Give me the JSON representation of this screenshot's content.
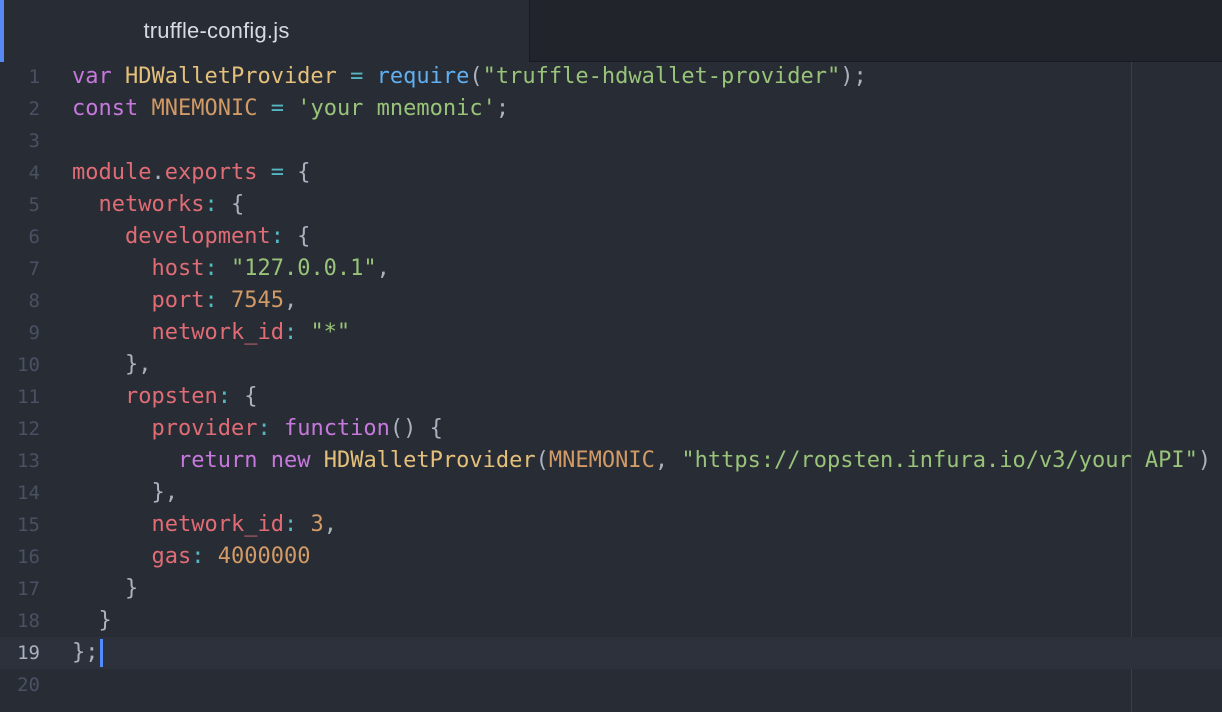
{
  "tab": {
    "title": "truffle-config.js"
  },
  "editor": {
    "cursor_line": 19,
    "lines": [
      {
        "number": "1",
        "tokens": [
          {
            "t": "var",
            "c": "keyword"
          },
          {
            "t": " ",
            "c": "punct"
          },
          {
            "t": "HDWalletProvider",
            "c": "class"
          },
          {
            "t": " ",
            "c": "punct"
          },
          {
            "t": "=",
            "c": "op"
          },
          {
            "t": " ",
            "c": "punct"
          },
          {
            "t": "require",
            "c": "func"
          },
          {
            "t": "(",
            "c": "punct"
          },
          {
            "t": "\"truffle-hdwallet-provider\"",
            "c": "string"
          },
          {
            "t": ");",
            "c": "punct"
          }
        ]
      },
      {
        "number": "2",
        "tokens": [
          {
            "t": "const",
            "c": "keyword"
          },
          {
            "t": " ",
            "c": "punct"
          },
          {
            "t": "MNEMONIC",
            "c": "const"
          },
          {
            "t": " ",
            "c": "punct"
          },
          {
            "t": "=",
            "c": "op"
          },
          {
            "t": " ",
            "c": "punct"
          },
          {
            "t": "'your mnemonic'",
            "c": "string"
          },
          {
            "t": ";",
            "c": "punct"
          }
        ]
      },
      {
        "number": "3",
        "tokens": []
      },
      {
        "number": "4",
        "tokens": [
          {
            "t": "module",
            "c": "var"
          },
          {
            "t": ".",
            "c": "punct"
          },
          {
            "t": "exports",
            "c": "var"
          },
          {
            "t": " ",
            "c": "punct"
          },
          {
            "t": "=",
            "c": "op"
          },
          {
            "t": " {",
            "c": "punct"
          }
        ]
      },
      {
        "number": "5",
        "tokens": [
          {
            "t": "  ",
            "c": "punct"
          },
          {
            "t": "networks",
            "c": "prop"
          },
          {
            "t": ":",
            "c": "op"
          },
          {
            "t": " {",
            "c": "punct"
          }
        ]
      },
      {
        "number": "6",
        "tokens": [
          {
            "t": "    ",
            "c": "punct"
          },
          {
            "t": "development",
            "c": "prop"
          },
          {
            "t": ":",
            "c": "op"
          },
          {
            "t": " {",
            "c": "punct"
          }
        ]
      },
      {
        "number": "7",
        "tokens": [
          {
            "t": "      ",
            "c": "punct"
          },
          {
            "t": "host",
            "c": "prop"
          },
          {
            "t": ":",
            "c": "op"
          },
          {
            "t": " ",
            "c": "punct"
          },
          {
            "t": "\"127.0.0.1\"",
            "c": "string"
          },
          {
            "t": ",",
            "c": "punct"
          }
        ]
      },
      {
        "number": "8",
        "tokens": [
          {
            "t": "      ",
            "c": "punct"
          },
          {
            "t": "port",
            "c": "prop"
          },
          {
            "t": ":",
            "c": "op"
          },
          {
            "t": " ",
            "c": "punct"
          },
          {
            "t": "7545",
            "c": "number"
          },
          {
            "t": ",",
            "c": "punct"
          }
        ]
      },
      {
        "number": "9",
        "tokens": [
          {
            "t": "      ",
            "c": "punct"
          },
          {
            "t": "network_id",
            "c": "prop"
          },
          {
            "t": ":",
            "c": "op"
          },
          {
            "t": " ",
            "c": "punct"
          },
          {
            "t": "\"*\"",
            "c": "string"
          }
        ]
      },
      {
        "number": "10",
        "tokens": [
          {
            "t": "    },",
            "c": "punct"
          }
        ]
      },
      {
        "number": "11",
        "tokens": [
          {
            "t": "    ",
            "c": "punct"
          },
          {
            "t": "ropsten",
            "c": "prop"
          },
          {
            "t": ":",
            "c": "op"
          },
          {
            "t": " {",
            "c": "punct"
          }
        ]
      },
      {
        "number": "12",
        "tokens": [
          {
            "t": "      ",
            "c": "punct"
          },
          {
            "t": "provider",
            "c": "prop"
          },
          {
            "t": ":",
            "c": "op"
          },
          {
            "t": " ",
            "c": "punct"
          },
          {
            "t": "function",
            "c": "keyword"
          },
          {
            "t": "() {",
            "c": "punct"
          }
        ]
      },
      {
        "number": "13",
        "tokens": [
          {
            "t": "        ",
            "c": "punct"
          },
          {
            "t": "return",
            "c": "keyword"
          },
          {
            "t": " ",
            "c": "punct"
          },
          {
            "t": "new",
            "c": "keyword"
          },
          {
            "t": " ",
            "c": "punct"
          },
          {
            "t": "HDWalletProvider",
            "c": "class"
          },
          {
            "t": "(",
            "c": "punct"
          },
          {
            "t": "MNEMONIC",
            "c": "const"
          },
          {
            "t": ", ",
            "c": "punct"
          },
          {
            "t": "\"https://ropsten.infura.io/v3/your API\"",
            "c": "string"
          },
          {
            "t": ")",
            "c": "punct"
          }
        ]
      },
      {
        "number": "14",
        "tokens": [
          {
            "t": "      },",
            "c": "punct"
          }
        ]
      },
      {
        "number": "15",
        "tokens": [
          {
            "t": "      ",
            "c": "punct"
          },
          {
            "t": "network_id",
            "c": "prop"
          },
          {
            "t": ":",
            "c": "op"
          },
          {
            "t": " ",
            "c": "punct"
          },
          {
            "t": "3",
            "c": "number"
          },
          {
            "t": ",",
            "c": "punct"
          }
        ]
      },
      {
        "number": "16",
        "tokens": [
          {
            "t": "      ",
            "c": "punct"
          },
          {
            "t": "gas",
            "c": "prop"
          },
          {
            "t": ":",
            "c": "op"
          },
          {
            "t": " ",
            "c": "punct"
          },
          {
            "t": "4000000",
            "c": "number"
          }
        ]
      },
      {
        "number": "17",
        "tokens": [
          {
            "t": "    }",
            "c": "punct"
          }
        ]
      },
      {
        "number": "18",
        "tokens": [
          {
            "t": "  }",
            "c": "punct"
          }
        ]
      },
      {
        "number": "19",
        "tokens": [
          {
            "t": "};",
            "c": "punct"
          }
        ]
      },
      {
        "number": "20",
        "tokens": []
      }
    ]
  },
  "colors": {
    "background": "#282c34",
    "tab_accent": "#568af2",
    "keyword": "#c678dd",
    "class": "#e5c07b",
    "string": "#98c379",
    "number": "#d19a66",
    "property": "#e06c75",
    "function": "#61afef",
    "operator": "#56b6c2"
  }
}
